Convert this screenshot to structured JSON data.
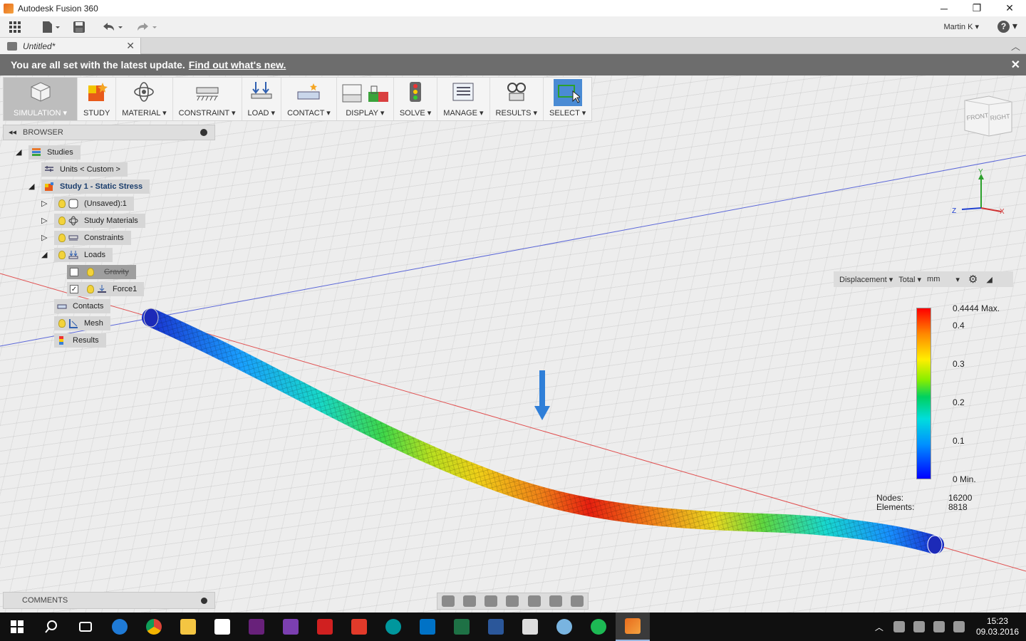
{
  "window": {
    "title": "Autodesk Fusion 360",
    "minimize": "─",
    "restore": "❐",
    "close": "✕"
  },
  "quick_access": {
    "user": "Martin K ▾",
    "help": "?"
  },
  "document_tab": {
    "name": "Untitled*",
    "close": "✕"
  },
  "banner": {
    "text": "You are all set with the latest update.",
    "link": "Find out what's new.",
    "close": "✕"
  },
  "toolbar": {
    "workspace": "SIMULATION ▾",
    "items": [
      {
        "label": "STUDY",
        "icon": "study-icon"
      },
      {
        "label": "MATERIAL ▾",
        "icon": "material-icon"
      },
      {
        "label": "CONSTRAINT ▾",
        "icon": "constraint-icon"
      },
      {
        "label": "LOAD ▾",
        "icon": "load-icon"
      },
      {
        "label": "CONTACT ▾",
        "icon": "contact-icon"
      },
      {
        "label": "DISPLAY ▾",
        "icon": "display-icon"
      },
      {
        "label": "SOLVE ▾",
        "icon": "solve-icon"
      },
      {
        "label": "MANAGE ▾",
        "icon": "manage-icon"
      },
      {
        "label": "RESULTS ▾",
        "icon": "results-icon"
      },
      {
        "label": "SELECT ▾",
        "icon": "select-icon"
      }
    ]
  },
  "browser": {
    "title": "BROWSER",
    "nodes": {
      "studies": "Studies",
      "units": "Units < Custom >",
      "study1": "Study 1 - Static Stress",
      "unsaved": "(Unsaved):1",
      "materials": "Study Materials",
      "constraints": "Constraints",
      "loads": "Loads",
      "gravity": "Gravity",
      "force": "Force1",
      "contacts": "Contacts",
      "mesh": "Mesh",
      "results": "Results"
    }
  },
  "results_panel": {
    "type": "Displacement ▾",
    "component": "Total ▾",
    "unit": "mm",
    "legend": {
      "max": "0.4444 Max.",
      "t4": "0.4",
      "t3": "0.3",
      "t2": "0.2",
      "t1": "0.1",
      "min": "0 Min."
    },
    "nodes_label": "Nodes:",
    "nodes_value": "16200",
    "elements_label": "Elements:",
    "elements_value": "8818"
  },
  "comments": {
    "title": "COMMENTS"
  },
  "viewcube": {
    "front": "FRONT",
    "right": "RIGHT"
  },
  "axes": {
    "x": "X",
    "y": "Y",
    "z": "Z"
  },
  "clock": {
    "time": "15:23",
    "date": "09.03.2016"
  },
  "colors": {
    "banner_bg": "#6d6d6d",
    "taskbar_bg": "#101010",
    "load_arrow": "#2f7fd8"
  }
}
